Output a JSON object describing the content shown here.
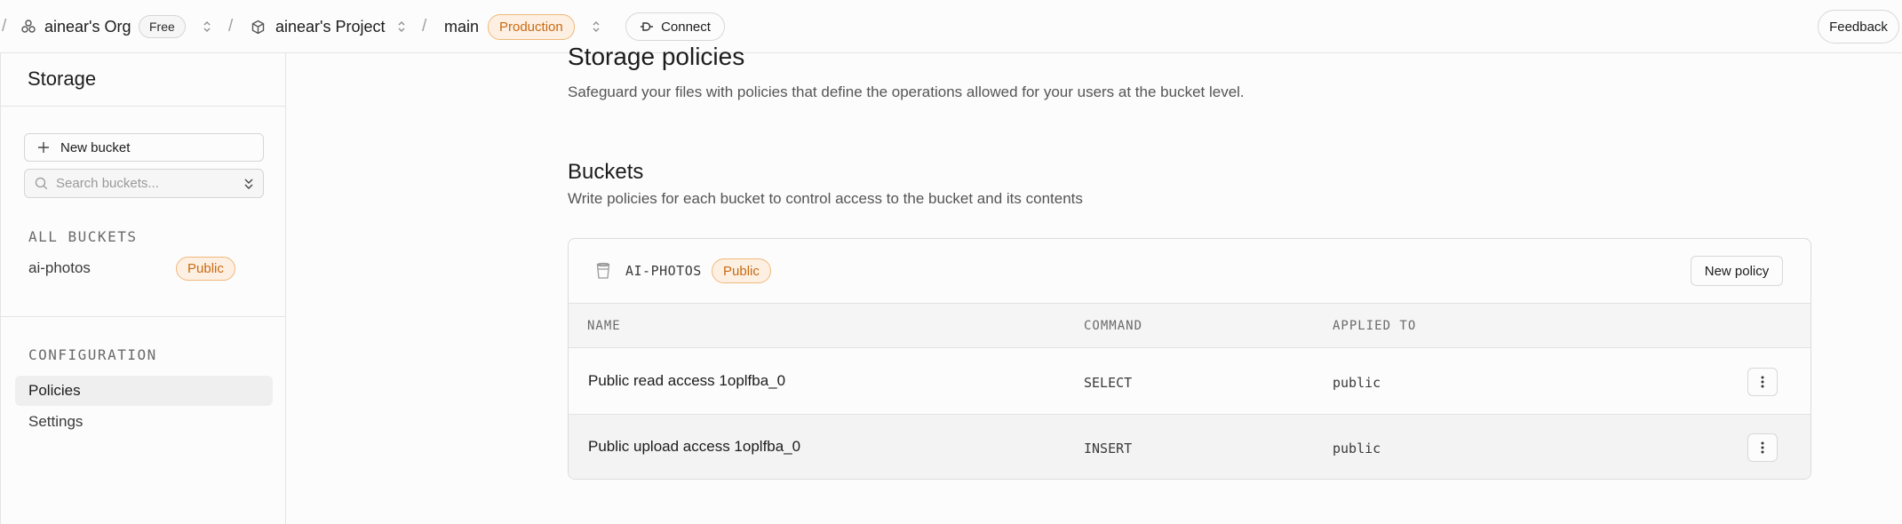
{
  "topbar": {
    "org_name": "ainear's Org",
    "org_plan": "Free",
    "project_name": "ainear's Project",
    "branch": "main",
    "env_badge": "Production",
    "connect_label": "Connect",
    "feedback_label": "Feedback"
  },
  "sidebar": {
    "title": "Storage",
    "new_bucket_label": "New bucket",
    "search_placeholder": "Search buckets...",
    "all_buckets_heading": "ALL BUCKETS",
    "buckets": [
      {
        "name": "ai-photos",
        "badge": "Public"
      }
    ],
    "configuration_heading": "CONFIGURATION",
    "config_items": [
      {
        "label": "Policies",
        "active": true
      },
      {
        "label": "Settings",
        "active": false
      }
    ]
  },
  "main": {
    "title": "Storage policies",
    "subtitle": "Safeguard your files with policies that define the operations allowed for your users at the bucket level.",
    "buckets_heading": "Buckets",
    "buckets_subtitle": "Write policies for each bucket to control access to the bucket and its contents",
    "bucket_card": {
      "bucket_name": "AI-PHOTOS",
      "bucket_badge": "Public",
      "new_policy_label": "New policy",
      "columns": [
        "NAME",
        "COMMAND",
        "APPLIED TO"
      ],
      "rows": [
        {
          "name": "Public read access 1oplfba_0",
          "command": "SELECT",
          "applied_to": "public"
        },
        {
          "name": "Public upload access 1oplfba_0",
          "command": "INSERT",
          "applied_to": "public"
        }
      ]
    }
  },
  "colors": {
    "accent_orange": "#c86a12",
    "badge_orange_bg": "#fdf0e2",
    "border": "#e4e4e4"
  }
}
